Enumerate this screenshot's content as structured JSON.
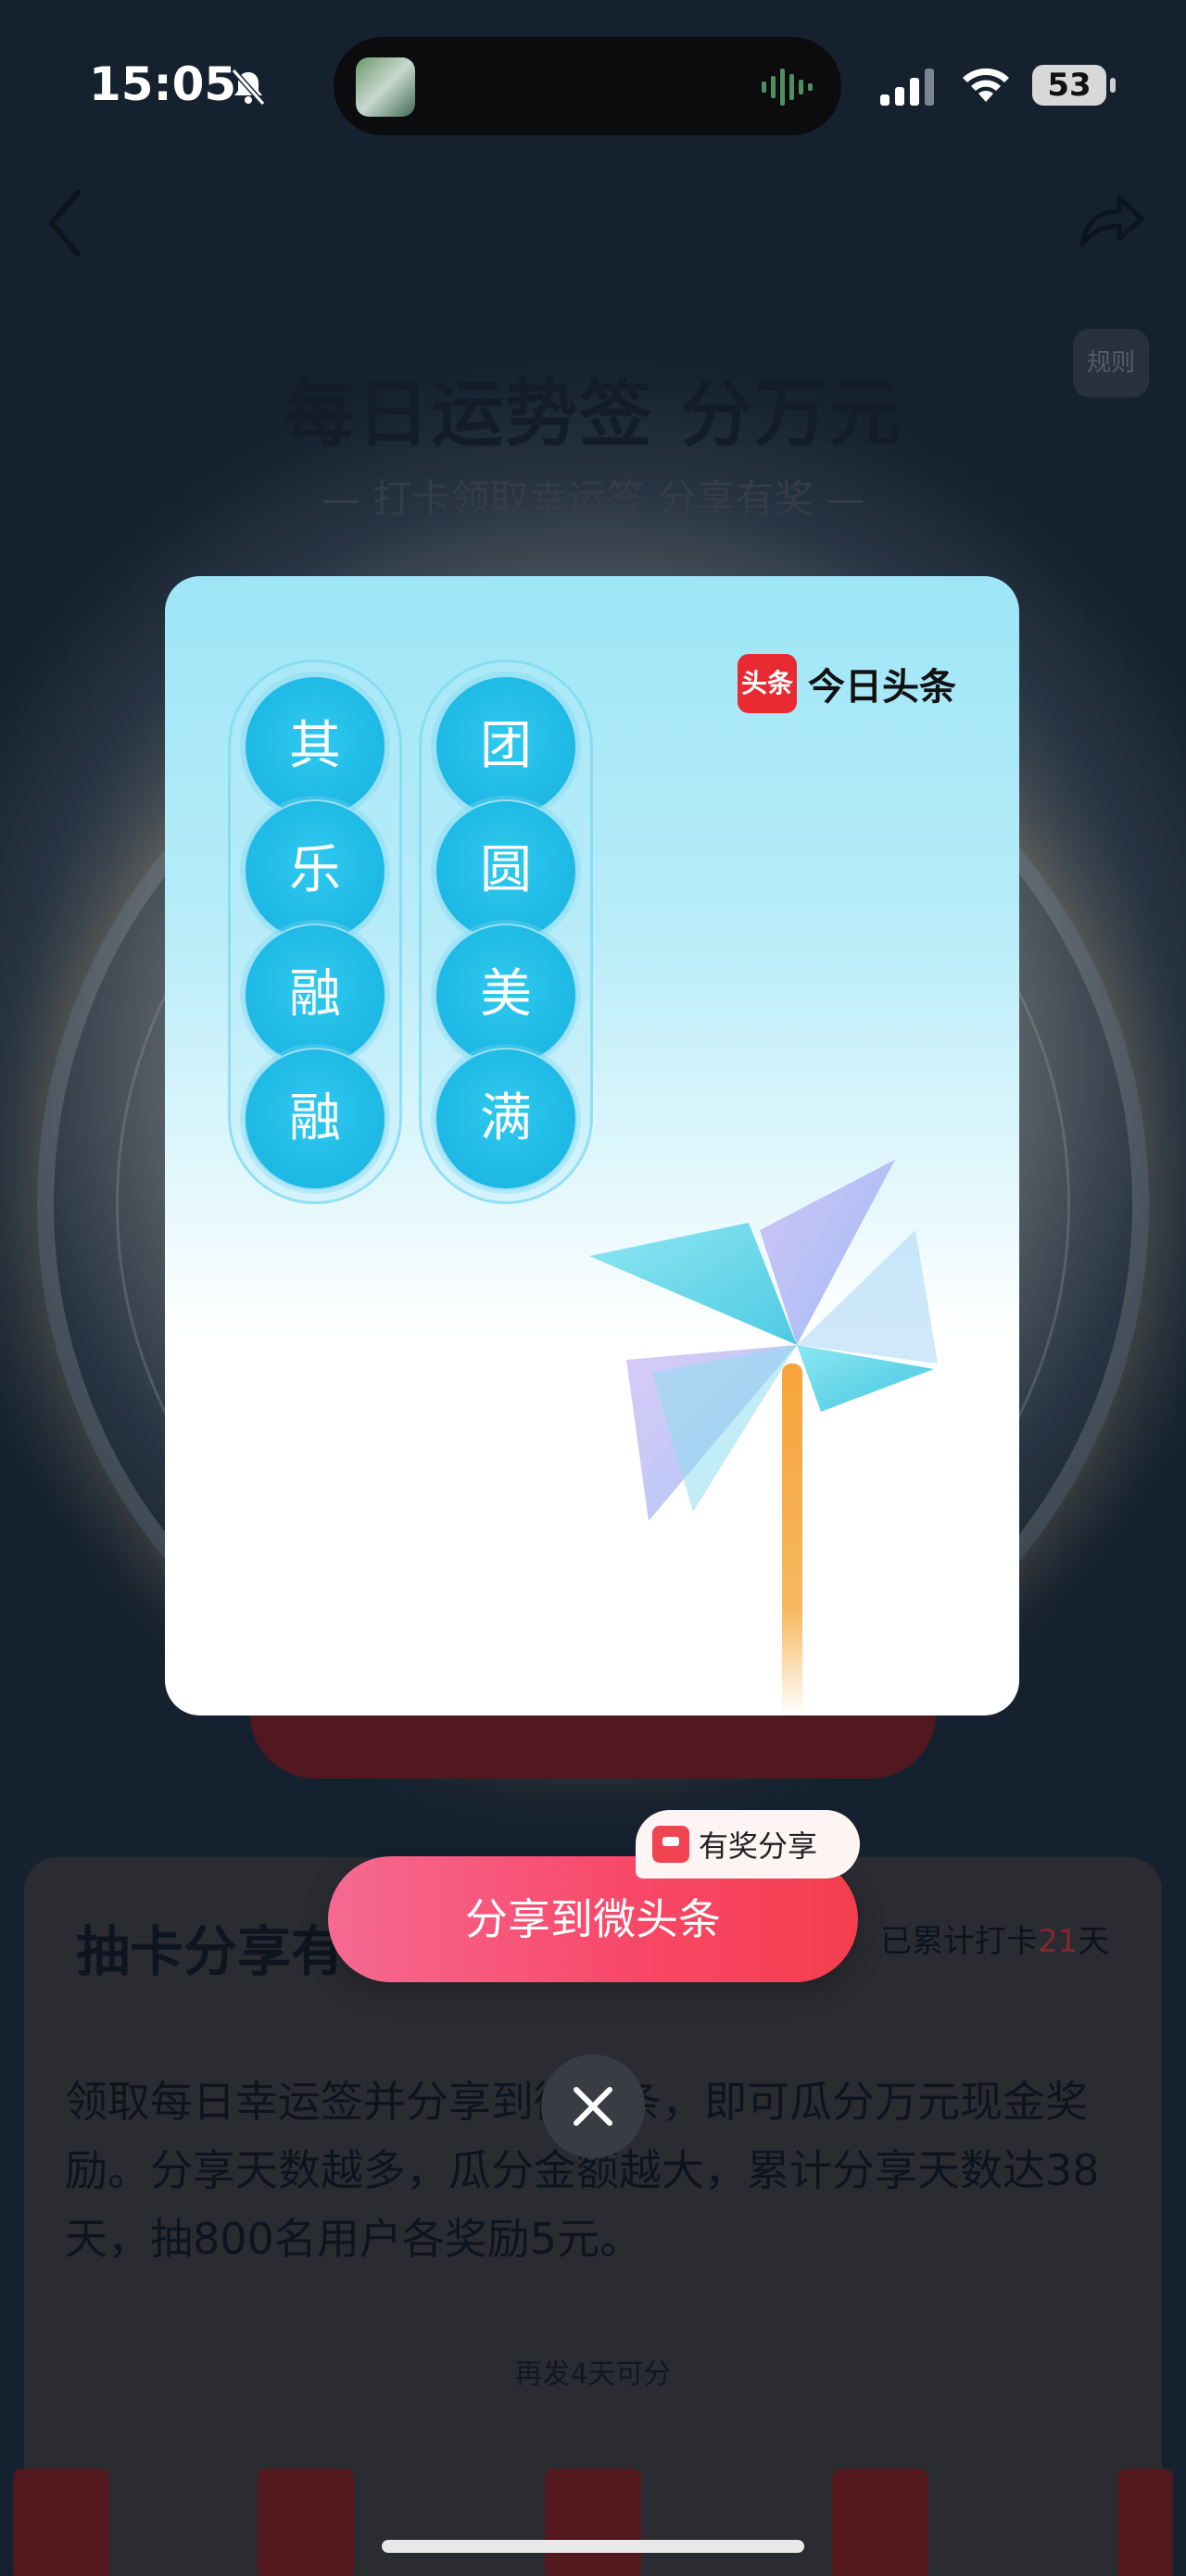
{
  "status_bar": {
    "time": "15:05",
    "battery": "53"
  },
  "nav": {
    "back_icon": "chevron-left-icon",
    "share_icon": "share-arrow-icon"
  },
  "background_page": {
    "title": "每日运势签 分万元",
    "subtitle": "— 打卡领取幸运签 分享有奖 —",
    "rules": "规则",
    "section_title": "抽卡分享有",
    "streak_prefix": "已累计打卡",
    "streak_days": "21",
    "streak_suffix": "天",
    "description": "领取每日幸运签并分享到微头条，即可瓜分万元现金奖励。分享天数越多，瓜分金额越大，累计分享天数达38天，抽800名用户各奖励5元。",
    "hint": "再发4天可分"
  },
  "card": {
    "brand_mark": "头条",
    "brand_name": "今日头条",
    "left_column": [
      "其",
      "乐",
      "融",
      "融"
    ],
    "right_column": [
      "团",
      "圆",
      "美",
      "满"
    ],
    "colors": {
      "orb": "#1fbbe6",
      "card_top": "#9ee6f7"
    }
  },
  "actions": {
    "share_label": "分享到微头条",
    "reward_badge": "有奖分享",
    "close_icon": "close-icon",
    "accent_color": "#f8496a"
  }
}
